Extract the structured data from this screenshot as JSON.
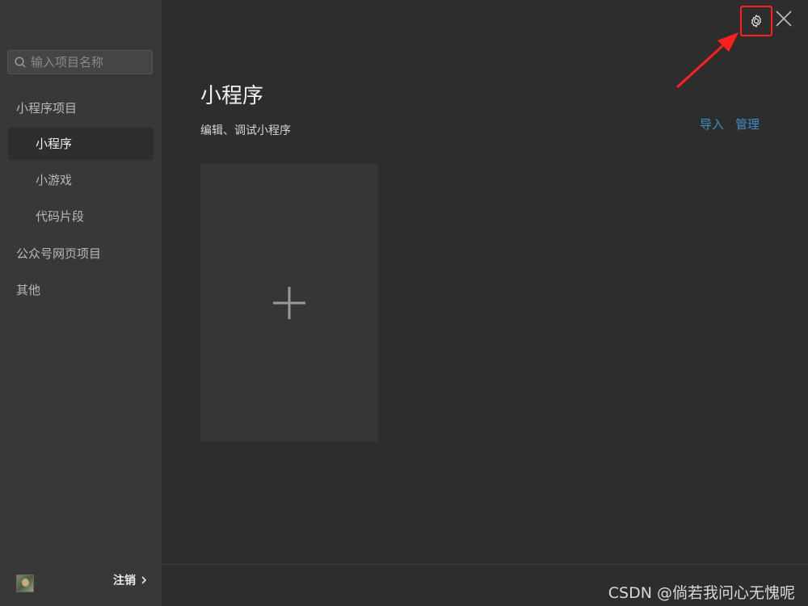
{
  "sidebar": {
    "search_placeholder": "输入项目名称",
    "groups": [
      {
        "label": "小程序项目"
      },
      {
        "label": "公众号网页项目"
      },
      {
        "label": "其他"
      }
    ],
    "items": [
      {
        "label": "小程序",
        "active": true
      },
      {
        "label": "小游戏",
        "active": false
      },
      {
        "label": "代码片段",
        "active": false
      }
    ],
    "footer": {
      "logout_label": "注销"
    }
  },
  "header": {
    "title": "小程序",
    "subtitle": "编辑、调试小程序",
    "actions": {
      "import_label": "导入",
      "manage_label": "管理"
    }
  },
  "icons": {
    "settings": "gear-icon",
    "close": "close-icon",
    "add": "plus-icon",
    "search": "search-icon"
  },
  "watermark": "CSDN @倘若我问心无愧呢",
  "colors": {
    "accent_link": "#3e8fc9",
    "highlight_border": "#ff1f1f",
    "sidebar_bg": "#383838",
    "main_bg": "#2d2d2d"
  }
}
